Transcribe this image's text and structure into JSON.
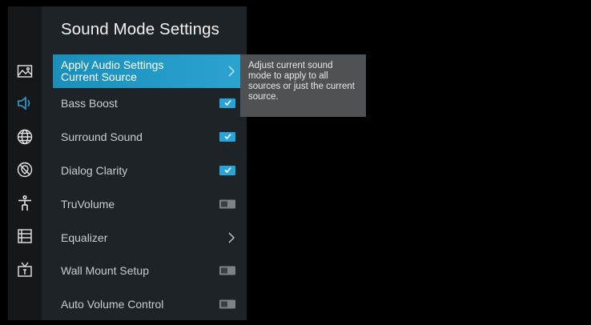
{
  "panel": {
    "title": "Sound Mode Settings",
    "items": [
      {
        "label": "Apply Audio Settings\nCurrent Source",
        "control": "chevron",
        "selected": true
      },
      {
        "label": "Bass Boost",
        "control": "checkbox",
        "checked": true
      },
      {
        "label": "Surround Sound",
        "control": "checkbox",
        "checked": true
      },
      {
        "label": "Dialog Clarity",
        "control": "checkbox",
        "checked": true
      },
      {
        "label": "TruVolume",
        "control": "toggle",
        "checked": false
      },
      {
        "label": "Equalizer",
        "control": "chevron"
      },
      {
        "label": "Wall Mount Setup",
        "control": "toggle",
        "checked": false
      },
      {
        "label": "Auto Volume Control",
        "control": "toggle",
        "checked": false
      }
    ]
  },
  "tooltip": {
    "text": "Adjust current sound mode to apply to all sources or just the current source."
  },
  "rail": {
    "icons": [
      "picture-icon",
      "sound-icon",
      "network-icon",
      "location-icon",
      "accessibility-icon",
      "system-icon",
      "tv-icon"
    ],
    "active": "sound-icon"
  },
  "colors": {
    "accent": "#2aa3d6",
    "selected_bg": "#1a8fbc",
    "panel_bg": "#1e2328",
    "rail_bg": "#15181b",
    "tooltip_bg": "#4e5254"
  }
}
